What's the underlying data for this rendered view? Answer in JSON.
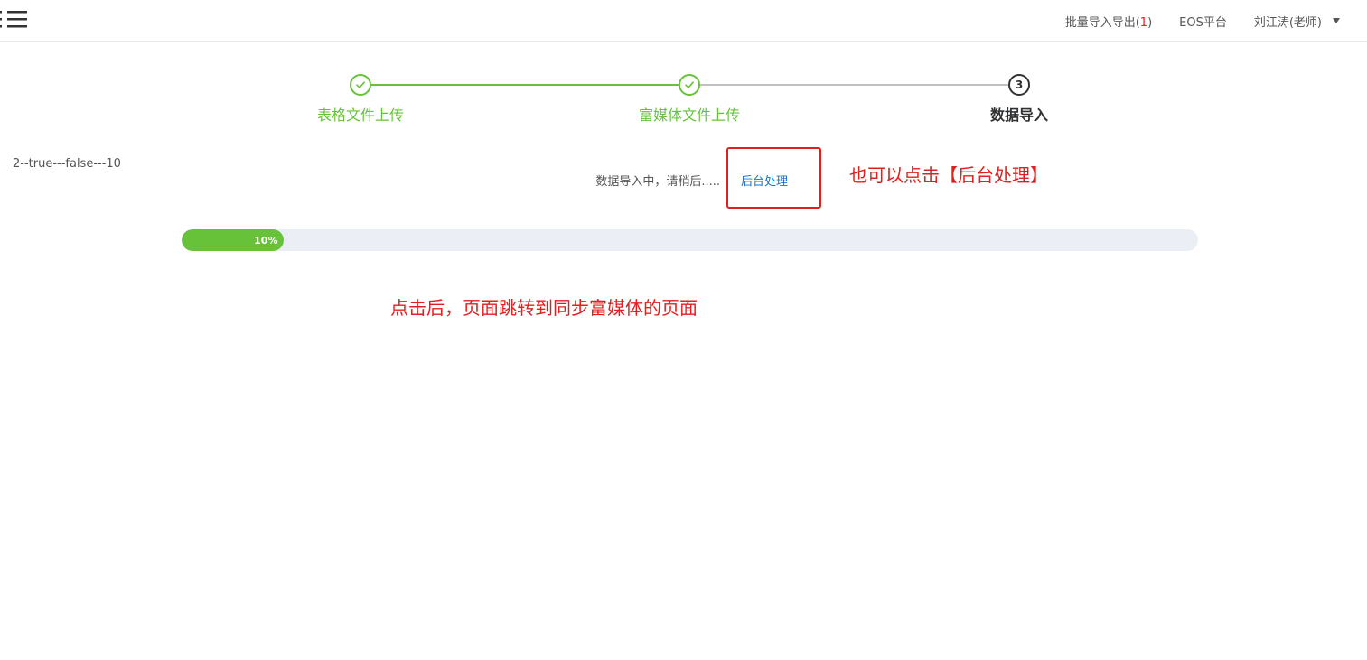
{
  "header": {
    "nav": {
      "batch_label": "批量导入导出(",
      "batch_count": "1",
      "batch_suffix": ")",
      "eos_label": "EOS平台",
      "user_label": "刘江涛(老师)"
    }
  },
  "steps": [
    {
      "title": "表格文件上传",
      "state": "done"
    },
    {
      "title": "富媒体文件上传",
      "state": "done"
    },
    {
      "title": "数据导入",
      "state": "active",
      "number": "3"
    }
  ],
  "main": {
    "debug_text": "2--true---false---10",
    "status_text": "数据导入中，请稍后.....",
    "background_link": "后台处理",
    "progress": {
      "percent": 10,
      "label": "10%"
    }
  },
  "annotations": {
    "note_1": "也可以点击【后台处理】",
    "note_2": "点击后，页面跳转到同步富媒体的页面"
  },
  "colors": {
    "success": "#67c23a",
    "annotation": "#e02020",
    "link": "#1a73c8",
    "track": "#ebeef5"
  }
}
